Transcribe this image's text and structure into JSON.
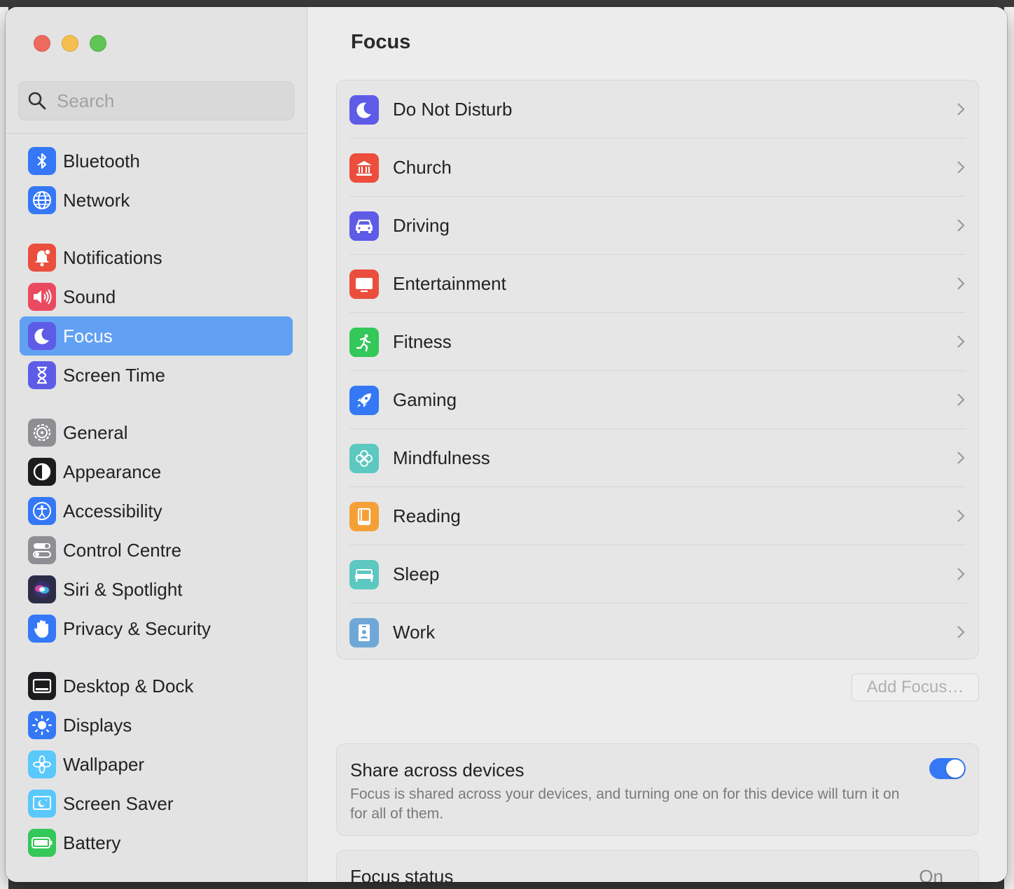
{
  "window": {
    "title": "Focus"
  },
  "search": {
    "placeholder": "Search"
  },
  "sidebar": {
    "items": [
      {
        "label": "Bluetooth",
        "icon": "bluetooth-icon",
        "color": "#3478f6"
      },
      {
        "label": "Network",
        "icon": "globe-icon",
        "color": "#3478f6"
      },
      {
        "label": "Notifications",
        "icon": "bell-icon",
        "color": "#eb4e3d"
      },
      {
        "label": "Sound",
        "icon": "speaker-icon",
        "color": "#ea4a5f"
      },
      {
        "label": "Focus",
        "icon": "moon-icon",
        "color": "#5e5ce6",
        "selected": true
      },
      {
        "label": "Screen Time",
        "icon": "hourglass-icon",
        "color": "#5e5ce6"
      },
      {
        "label": "General",
        "icon": "gear-icon",
        "color": "#8e8e93"
      },
      {
        "label": "Appearance",
        "icon": "appearance-icon",
        "color": "#1c1c1e"
      },
      {
        "label": "Accessibility",
        "icon": "accessibility-icon",
        "color": "#3478f6"
      },
      {
        "label": "Control Centre",
        "icon": "toggles-icon",
        "color": "#8e8e93"
      },
      {
        "label": "Siri & Spotlight",
        "icon": "siri-icon",
        "color": "#2c2c48"
      },
      {
        "label": "Privacy & Security",
        "icon": "hand-icon",
        "color": "#3478f6"
      },
      {
        "label": "Desktop & Dock",
        "icon": "dock-icon",
        "color": "#1c1c1e"
      },
      {
        "label": "Displays",
        "icon": "sun-icon",
        "color": "#3478f6"
      },
      {
        "label": "Wallpaper",
        "icon": "flower-icon",
        "color": "#5ac8fa"
      },
      {
        "label": "Screen Saver",
        "icon": "screensaver-icon",
        "color": "#5ac8fa"
      },
      {
        "label": "Battery",
        "icon": "battery-icon",
        "color": "#34c759"
      }
    ]
  },
  "focus_modes": [
    {
      "label": "Do Not Disturb",
      "icon": "moon-icon",
      "color": "#5e5ce6"
    },
    {
      "label": "Church",
      "icon": "building-columns-icon",
      "color": "#eb4e3d"
    },
    {
      "label": "Driving",
      "icon": "car-icon",
      "color": "#5e5ce6"
    },
    {
      "label": "Entertainment",
      "icon": "tv-icon",
      "color": "#eb4e3d"
    },
    {
      "label": "Fitness",
      "icon": "running-icon",
      "color": "#34c759"
    },
    {
      "label": "Gaming",
      "icon": "rocket-icon",
      "color": "#3478f6"
    },
    {
      "label": "Mindfulness",
      "icon": "flower-icon",
      "color": "#5cc8c0"
    },
    {
      "label": "Reading",
      "icon": "book-icon",
      "color": "#f5a037"
    },
    {
      "label": "Sleep",
      "icon": "bed-icon",
      "color": "#5cc8c0"
    },
    {
      "label": "Work",
      "icon": "badge-icon",
      "color": "#6fa8d6"
    }
  ],
  "add_focus_label": "Add Focus…",
  "share": {
    "title": "Share across devices",
    "description": "Focus is shared across your devices, and turning one on for this device will turn it on for all of them.",
    "enabled": true
  },
  "status": {
    "title": "Focus status",
    "value": "On"
  }
}
